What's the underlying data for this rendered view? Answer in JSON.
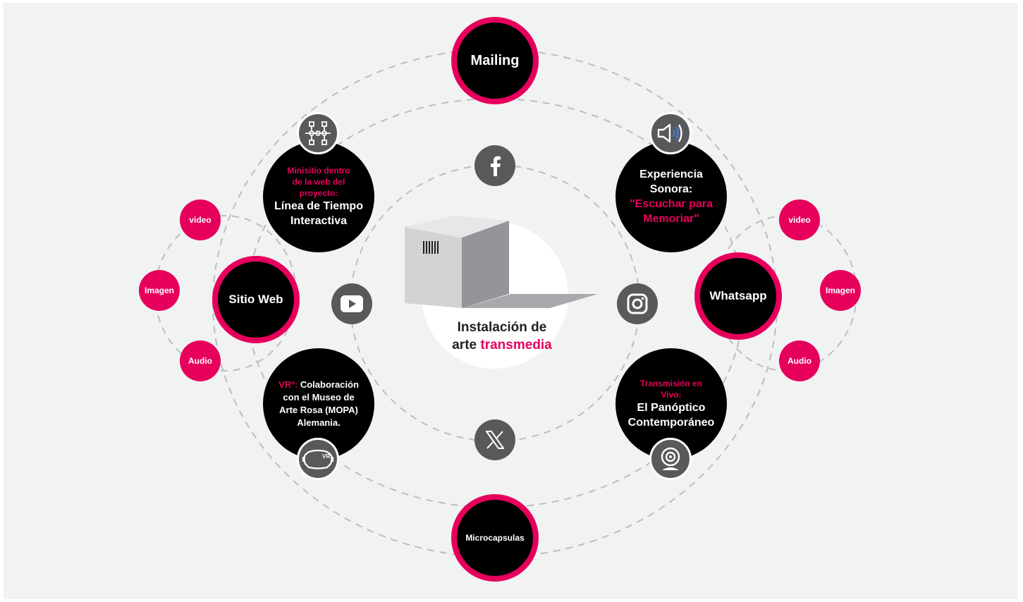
{
  "center": {
    "line1": "Instalación de",
    "line2_prefix": "arte ",
    "line2_highlight": "transmedia"
  },
  "nodes": {
    "mailing": "Mailing",
    "microcapsulas": "Microcapsulas",
    "sitio_web": "Sitio Web",
    "whatsapp": "Whatsapp",
    "minisitio": {
      "subtitle_lines": [
        "Minisitio dentro",
        "de la  web del",
        "proyecto:"
      ],
      "title_lines": [
        "Línea de Tiempo",
        "Interactiva"
      ]
    },
    "experiencia": {
      "title_lines": [
        "Experiencia",
        "Sonora:"
      ],
      "highlight_lines": [
        "\"Escuchar para",
        "Memoriar\""
      ]
    },
    "vr": {
      "highlight": "VRº:",
      "rest": " Colaboración",
      "lines": [
        "con el Museo de",
        "Arte Rosa (MOPA)",
        "Alemania."
      ]
    },
    "transmision": {
      "subtitle_lines": [
        "Transmisión en",
        "Vivo:"
      ],
      "title_lines": [
        "El Panóptico",
        "Contemporáneo"
      ]
    }
  },
  "left_media": [
    "video",
    "Imagen",
    "Audio"
  ],
  "right_media": [
    "video",
    "Imagen",
    "Audio"
  ],
  "icons": {
    "facebook": "facebook-icon",
    "youtube": "youtube-icon",
    "instagram": "instagram-icon",
    "x": "x-icon",
    "flowchart": "flowchart-icon",
    "speaker": "speaker-icon",
    "vr_headset": "vr-headset-icon",
    "webcam": "webcam-icon"
  },
  "colors": {
    "accent": "#e6005c",
    "node": "#000000",
    "icon_bg": "#58595b",
    "background": "#f1f2f2",
    "dashed_line": "#bcbec0"
  }
}
